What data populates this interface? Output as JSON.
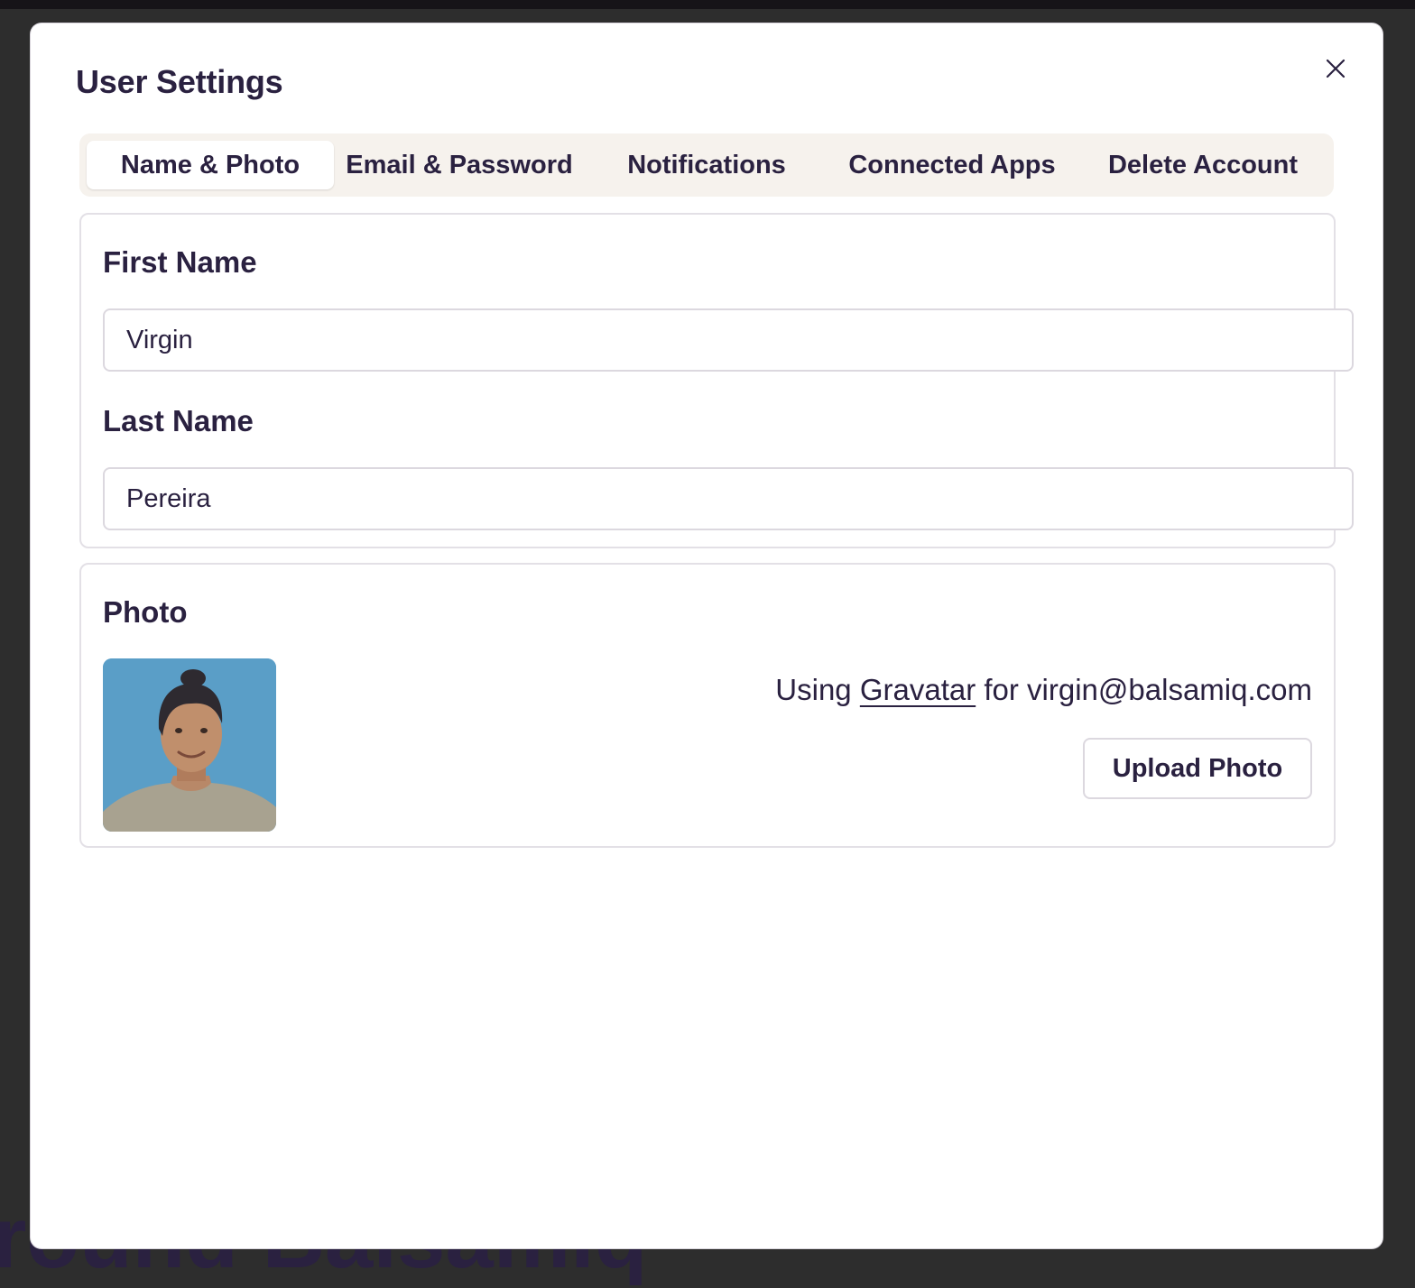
{
  "background": {
    "text": "round Balsamiq"
  },
  "modal": {
    "title": "User Settings",
    "close_icon": "close-icon"
  },
  "tabs": [
    {
      "label": "Name & Photo",
      "active": true
    },
    {
      "label": "Email & Password",
      "active": false
    },
    {
      "label": "Notifications",
      "active": false
    },
    {
      "label": "Connected Apps",
      "active": false
    },
    {
      "label": "Delete Account",
      "active": false
    }
  ],
  "name_section": {
    "first_name_label": "First Name",
    "first_name_value": "Virgin",
    "last_name_label": "Last Name",
    "last_name_value": "Pereira"
  },
  "photo_section": {
    "label": "Photo",
    "avatar_icon": "user-photo",
    "using_text": "Using",
    "gravatar_link": "Gravatar",
    "for_text": "for virgin@balsamiq.com",
    "upload_button": "Upload Photo"
  },
  "colors": {
    "text": "#2a2140",
    "tab_bar": "#f6f2ed",
    "overlay": "#2d2d2d",
    "avatar_bg": "#5a9ec7"
  }
}
